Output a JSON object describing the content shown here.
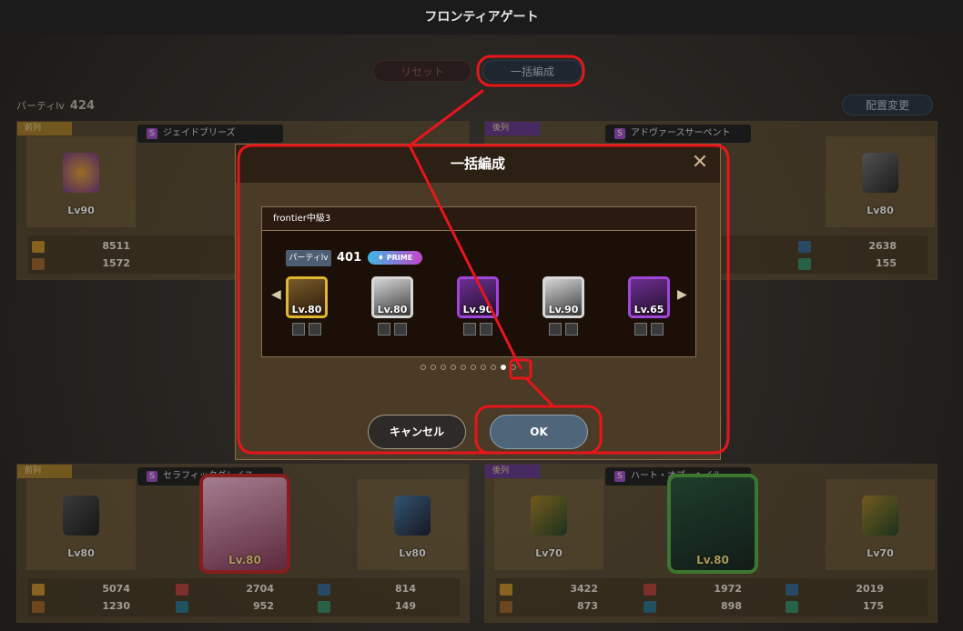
{
  "window": {
    "title": "フロンティアゲート"
  },
  "toolbar": {
    "reset_label": "リセット",
    "bulk_label": "一括編成",
    "reposition_label": "配置変更"
  },
  "party": {
    "label": "パーティlv",
    "value": "424"
  },
  "panels": [
    {
      "tag": "前列",
      "name": "ジェイドブリーズ",
      "slot1_lv": "Lv90",
      "slot3_lv": "",
      "stats": {
        "hp": "8511",
        "spd": "1572"
      }
    },
    {
      "tag": "後列",
      "name": "アドヴァースサーペント",
      "slot3_lv": "Lv80",
      "stats": {
        "mat": "2638",
        "mdf": "155"
      }
    },
    {
      "tag": "前列",
      "name": "セラフィックグレイス",
      "slot1_lv": "Lv80",
      "hero_lv": "Lv.80",
      "slot3_lv": "Lv80",
      "stats": {
        "hp": "5074",
        "atk": "2704",
        "mat": "814",
        "spd": "1230",
        "def": "952",
        "mdf": "149"
      }
    },
    {
      "tag": "後列",
      "name": "ハート・オブ・ヘイル",
      "slot1_lv": "Lv70",
      "hero_lv": "Lv.80",
      "slot3_lv": "Lv70",
      "stats": {
        "hp": "3422",
        "atk": "1972",
        "mat": "2019",
        "spd": "873",
        "def": "898",
        "mdf": "175"
      }
    }
  ],
  "modal": {
    "title": "一括編成",
    "close_icon": "close-icon",
    "preset_name": "frontier中級3",
    "party_label": "パーティlv",
    "party_value": "401",
    "prime_label": "PRIME",
    "units": [
      {
        "lv": "Lv.80",
        "frame": "gold"
      },
      {
        "lv": "Lv.80",
        "frame": "silver"
      },
      {
        "lv": "Lv.90",
        "frame": "violet"
      },
      {
        "lv": "Lv.90",
        "frame": "silver"
      },
      {
        "lv": "Lv.65",
        "frame": "violet"
      }
    ],
    "page_current": 9,
    "page_total": 10,
    "cancel_label": "キャンセル",
    "ok_label": "OK"
  },
  "colors": {
    "annotation": "#e8151b",
    "ok_button": "#4f6579"
  }
}
